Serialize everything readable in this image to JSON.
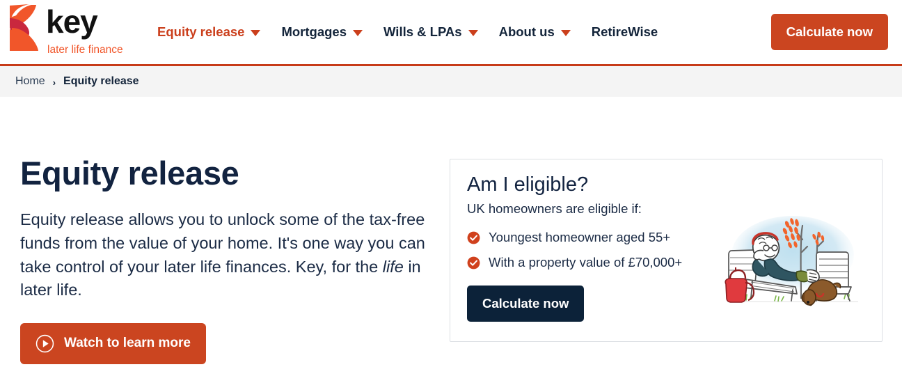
{
  "header": {
    "logo": {
      "word": "key",
      "tagline": "later life finance",
      "mark_icon": "key-logo-icon"
    },
    "nav": [
      {
        "label": "Equity release",
        "active": true,
        "has_caret": true
      },
      {
        "label": "Mortgages",
        "active": false,
        "has_caret": true
      },
      {
        "label": "Wills & LPAs",
        "active": false,
        "has_caret": true
      },
      {
        "label": "About us",
        "active": false,
        "has_caret": true
      },
      {
        "label": "RetireWise",
        "active": false,
        "has_caret": false
      }
    ],
    "cta_label": "Calculate now"
  },
  "breadcrumb": {
    "home": "Home",
    "separator": "›",
    "current": "Equity release"
  },
  "hero": {
    "title": "Equity release",
    "body_part1": "Equity release allows you to unlock some of the tax-free funds from the value of your home. It's one way you can take control of your later life finances. Key, for the ",
    "body_emphasis": "life",
    "body_part2": " in later life.",
    "watch_label": "Watch to learn more",
    "play_icon": "play-circle-icon"
  },
  "eligibility_card": {
    "title": "Am I eligible?",
    "subtitle": "UK homeowners are eligible if:",
    "items": [
      {
        "label": "Youngest homeowner aged 55+",
        "icon": "check-circle-icon"
      },
      {
        "label": "With a property value of £70,000+",
        "icon": "check-circle-icon"
      }
    ],
    "cta_label": "Calculate now",
    "illustration_icon": "person-relaxing-garden-illustration"
  },
  "colors": {
    "brand_orange": "#cb4520",
    "logo_orange": "#f1562a",
    "logo_crimson": "#c9283e",
    "navy": "#122340",
    "breadcrumb_bg": "#f4f4f4",
    "card_border": "#dcdfe3",
    "rule_orange": "#c73b18"
  }
}
